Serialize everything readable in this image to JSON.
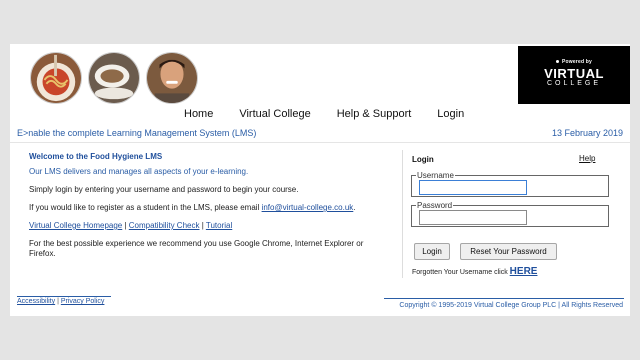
{
  "brand": {
    "powered_by": "Powered by",
    "name": "VIRTUAL",
    "name2": "COLLEGE"
  },
  "nav": {
    "items": [
      "Home",
      "Virtual College",
      "Help & Support",
      "Login"
    ]
  },
  "header": {
    "tagline": "E>nable the complete Learning Management System (LMS)",
    "date": "13 February 2019"
  },
  "main": {
    "title": "Welcome to the Food Hygiene LMS",
    "intro": "Our LMS delivers and manages all aspects of your e-learning.",
    "p1": "Simply login by entering your username and password to begin your course.",
    "p2_prefix": "If you would like to register as a student in the LMS, please email ",
    "email": "info@virtual-college.co.uk",
    "p2_suffix": ".",
    "links": [
      "Virtual College Homepage",
      "Compatibility Check",
      "Tutorial"
    ],
    "separator": " | ",
    "p3": "For the best possible experience we recommend you use Google Chrome, Internet Explorer or Firefox."
  },
  "login": {
    "title": "Login",
    "help": "Help",
    "username_label": "Username",
    "username_value": "",
    "password_label": "Password",
    "password_value": "",
    "login_button": "Login",
    "reset_button": "Reset Your Password",
    "forgot_prefix": "Forgotten Your Username click ",
    "forgot_link": "HERE"
  },
  "footer": {
    "accessibility": "Accessibility",
    "separator": " | ",
    "privacy": "Privacy Policy",
    "copyright": "Copyright © 1995-2019 Virtual College Group PLC | All Rights Reserved"
  },
  "colors": {
    "link_blue": "#1f4f9c",
    "text_blue": "#2a5da6",
    "logo_bg": "#000000"
  }
}
